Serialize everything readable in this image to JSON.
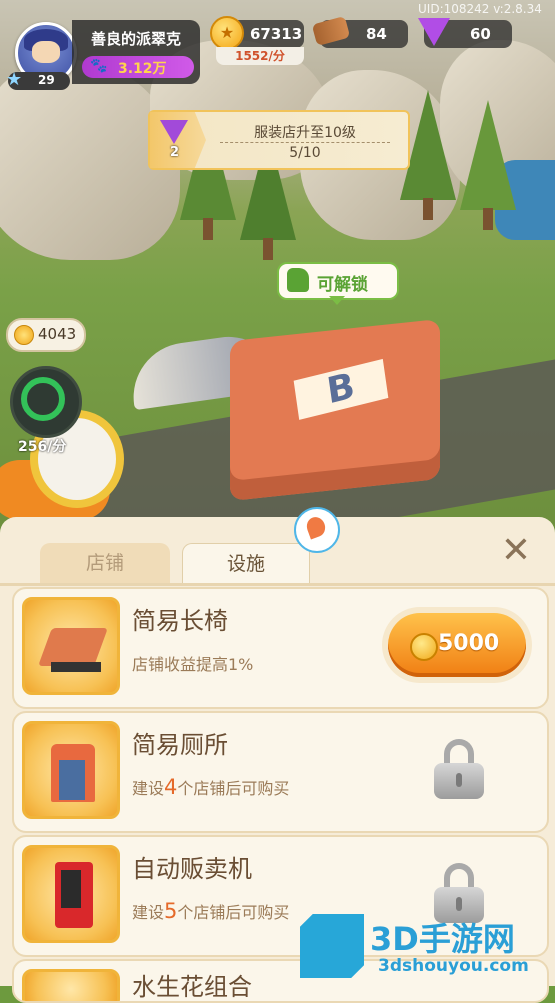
{
  "hud": {
    "player_name": "善良的派翠克",
    "player_level": "29",
    "fans": "3.12万",
    "coins": "67313",
    "coin_rate": "1552/分",
    "wood": "84",
    "gems": "60",
    "uid": "UID:108242 v:2.8.34"
  },
  "quest": {
    "reward_count": "2",
    "title": "服装店升至10级",
    "progress": "5/10"
  },
  "map": {
    "unlock_label": "可解锁",
    "pending_coins": "4043",
    "income_rate": "256/分",
    "store_sign": "B"
  },
  "panel": {
    "tabs": [
      "店铺",
      "设施"
    ],
    "active_tab": "设施",
    "close_label": "✕",
    "items": [
      {
        "name": "简易长椅",
        "desc": "店铺收益提高1%",
        "price": "5000"
      },
      {
        "name": "简易厕所",
        "desc_prefix": "建设",
        "desc_num": "4",
        "desc_suffix": "个店铺后可购买"
      },
      {
        "name": "自动贩卖机",
        "desc_prefix": "建设",
        "desc_num": "5",
        "desc_suffix": "个店铺后可购买"
      },
      {
        "name": "水生花组合"
      }
    ]
  },
  "watermark": {
    "title": "3D手游网",
    "url": "3dshouyou.com"
  },
  "colors": {
    "accent_orange": "#f07d12",
    "panel_bg": "#f6ecd8",
    "unlock_green": "#5aa334"
  }
}
